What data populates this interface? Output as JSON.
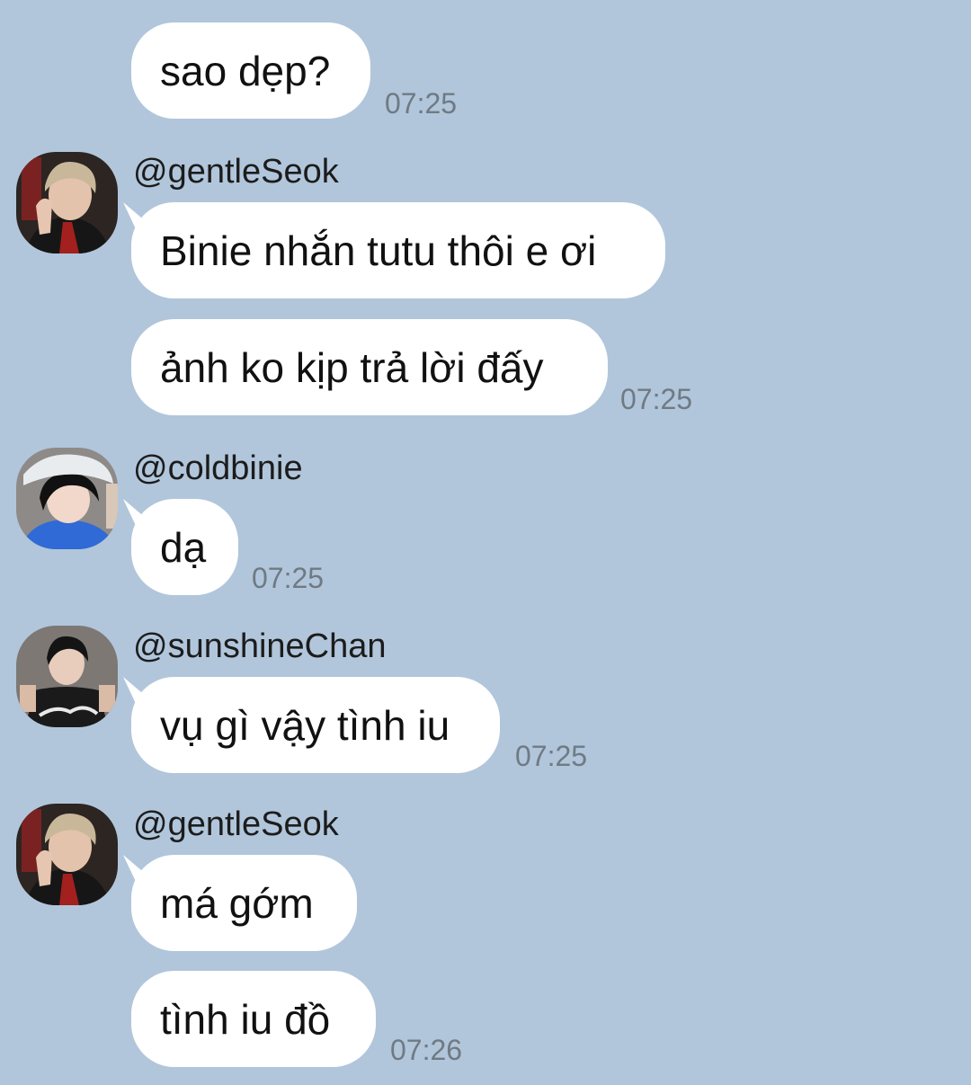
{
  "messages": [
    {
      "text": "sao dẹp?",
      "time": "07:25"
    },
    {
      "sender": "@gentleSeok",
      "text": "Binie nhắn tutu thôi e ơi"
    },
    {
      "text": "ảnh ko kịp trả lời đấy",
      "time": "07:25"
    },
    {
      "sender": "@coldbinie",
      "text": "dạ",
      "time": "07:25"
    },
    {
      "sender": "@sunshineChan",
      "text": "vụ gì vậy tình iu",
      "time": "07:25"
    },
    {
      "sender": "@gentleSeok",
      "text": "má gớm"
    },
    {
      "text": "tình iu đồ",
      "time": "07:26"
    }
  ],
  "avatars": [
    {
      "icon": "user-avatar-gentleseok"
    },
    {
      "icon": "user-avatar-coldbinie"
    },
    {
      "icon": "user-avatar-sunshinechan"
    },
    {
      "icon": "user-avatar-gentleseok"
    }
  ],
  "colors": {
    "background": "#b1c6db",
    "bubble": "#ffffff",
    "timestamp": "#6f7a84"
  }
}
